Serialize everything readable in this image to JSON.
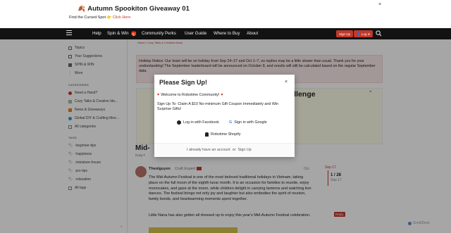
{
  "banner": {
    "title": "Autumn Spookiton Giveaway 01",
    "subtitle": "Find the Cursed Spot",
    "cta": "Click Here",
    "close": "×"
  },
  "nav": {
    "links": [
      "Help",
      "Spin & Win",
      "Community Perks",
      "User Guide",
      "Where to Buy",
      "About"
    ],
    "signup": "Sign Up",
    "login": "Log In"
  },
  "sidebar": {
    "top_items": [
      "Topics",
      "Your Suggestions",
      "SPIN & WIN",
      "More"
    ],
    "categories_heading": "CATEGORIES",
    "categories": [
      "Need a Hand?",
      "Cozy Talks & Creative Ide...",
      "News & Giveaways",
      "Global DIY & Crafting Mee...",
      "All categories"
    ],
    "tags_heading": "TAGS",
    "tags": [
      "beginner-tips",
      "happiness",
      "miniature-house",
      "pro-tips",
      "relaxation",
      "All tags"
    ],
    "collapse": "«"
  },
  "main": {
    "breadcrumb": "Home / Cozy Talks & Creative Ideas",
    "notice": "Holiday Notice: Our team will be on holiday from Sep 24–27 and Oct 1–7, so replies may be a little slower than usual. Thank you for your understanding! The September leaderboard will be announced on October 8, and results will still be calculated based on the regular September data.",
    "challenge_title": "hallenge",
    "topic_title": "Mid-",
    "topic_category": "Cozy T",
    "author": "Theolguyen",
    "author_title": "Craft Expert",
    "post_date": "Oct",
    "post_body": "The Mid-Autumn Festival is one of the most beloved traditional holidays in Vietnam, taking place on the full moon of the eighth lunar month. It is an occasion for families to reunite, enjoy mooncakes, and gaze at the moon, while children delight in carrying lanterns and watching lion dances. The festival brings not only joy and laughter but also embodies the spirit of reunion, family bonds, and heartwarming moments spent together.",
    "post_body2": "Little Nana has also gotten all dressed up to enjoy this year's Mid-Autumn Festival celebration.",
    "timeline_top": "Sep 17",
    "timeline_count": "1 / 28",
    "timeline_date": "Sep 17",
    "reply_badge": "Reply"
  },
  "modal": {
    "title": "Please Sign Up!",
    "close": "×",
    "welcome": "Welcome to Robotime Community!",
    "desc": "Sign Up To: Claim A $10 No-minimum Gift Coupon Immediately and Win Surprise Gifts!",
    "facebook": "Log in with Facebook",
    "google": "Sign in with Google",
    "shopify": "Robotime Shopify",
    "have_account": "I already have an account",
    "or": "or",
    "sign_up": "Sign Up"
  },
  "footer": {
    "scrolldeck": "ScrollDeck"
  },
  "colors": {
    "accent": "#c0392b",
    "nav_bg": "#121212",
    "notice_bg": "#fbeaea"
  }
}
